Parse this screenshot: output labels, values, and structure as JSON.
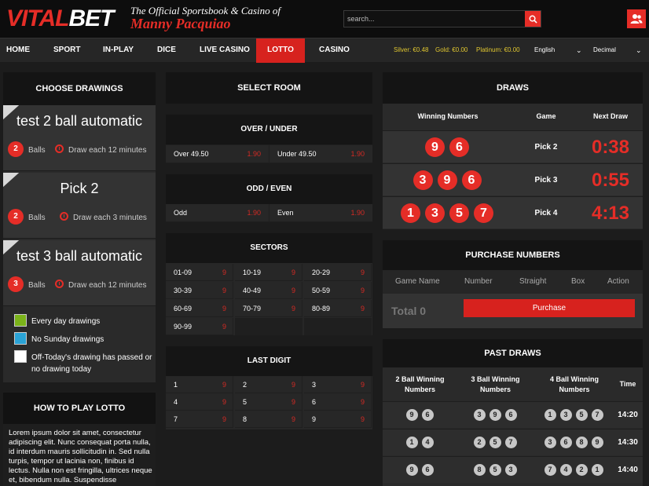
{
  "header": {
    "logo_part1": "VITAL",
    "logo_part2": "BET",
    "tagline_line1": "The Official Sportsbook & Casino of",
    "tagline_line2": "Manny Pacquiao",
    "search_placeholder": "search...",
    "brand_color": "#e52d27"
  },
  "nav": {
    "items": [
      "HOME",
      "SPORT",
      "IN-PLAY",
      "DICE",
      "LIVE CASINO",
      "LOTTO",
      "CASINO"
    ],
    "active": "LOTTO",
    "balances": [
      "Silver: €0.48",
      "Gold: €0.00",
      "Platinum: €0.00"
    ],
    "language": "English",
    "odds_format": "Decimal"
  },
  "choose": {
    "title": "CHOOSE DRAWINGS",
    "drawings": [
      {
        "name": "test 2 ball automatic",
        "balls": "2",
        "balls_label": "Balls",
        "every": "Draw each 12 minutes"
      },
      {
        "name": "Pick 2",
        "balls": "2",
        "balls_label": "Balls",
        "every": "Draw each 3 minutes"
      },
      {
        "name": "test 3 ball automatic",
        "balls": "3",
        "balls_label": "Balls",
        "every": "Draw each 12 minutes"
      }
    ],
    "legend": [
      {
        "color": "#7bb31a",
        "text": "Every day drawings"
      },
      {
        "color": "#2aa3d6",
        "text": "No Sunday drawings"
      },
      {
        "color": "#ffffff",
        "text": "Off-Today's drawing has passed or no drawing today"
      }
    ]
  },
  "howto": {
    "title": "HOW TO PLAY LOTTO",
    "text": "Lorem ipsum dolor sit amet, consectetur adipiscing elit. Nunc consequat porta nulla, id interdum mauris sollicitudin in. Sed nulla turpis, tempor ut lacinia non, finibus id lectus. Nulla non est fringilla, ultrices neque et, bibendum nulla. Suspendisse"
  },
  "room": {
    "title": "SELECT ROOM",
    "over_under": {
      "title": "OVER / UNDER",
      "bets": [
        {
          "label": "Over 49.50",
          "odd": "1.90"
        },
        {
          "label": "Under 49.50",
          "odd": "1.90"
        }
      ]
    },
    "odd_even": {
      "title": "ODD / EVEN",
      "bets": [
        {
          "label": "Odd",
          "odd": "1.90"
        },
        {
          "label": "Even",
          "odd": "1.90"
        }
      ]
    },
    "sectors": {
      "title": "SECTORS",
      "cells": [
        {
          "label": "01-09",
          "odd": "9"
        },
        {
          "label": "10-19",
          "odd": "9"
        },
        {
          "label": "20-29",
          "odd": "9"
        },
        {
          "label": "30-39",
          "odd": "9"
        },
        {
          "label": "40-49",
          "odd": "9"
        },
        {
          "label": "50-59",
          "odd": "9"
        },
        {
          "label": "60-69",
          "odd": "9"
        },
        {
          "label": "70-79",
          "odd": "9"
        },
        {
          "label": "80-89",
          "odd": "9"
        },
        {
          "label": "90-99",
          "odd": "9"
        }
      ]
    },
    "last_digit": {
      "title": "LAST DIGIT",
      "cells": [
        {
          "label": "1",
          "odd": "9"
        },
        {
          "label": "2",
          "odd": "9"
        },
        {
          "label": "3",
          "odd": "9"
        },
        {
          "label": "4",
          "odd": "9"
        },
        {
          "label": "5",
          "odd": "9"
        },
        {
          "label": "6",
          "odd": "9"
        },
        {
          "label": "7",
          "odd": "9"
        },
        {
          "label": "8",
          "odd": "9"
        },
        {
          "label": "9",
          "odd": "9"
        }
      ]
    }
  },
  "draws": {
    "title": "DRAWS",
    "col_winning": "Winning Numbers",
    "col_game": "Game",
    "col_next": "Next Draw",
    "rows": [
      {
        "numbers": [
          "9",
          "6"
        ],
        "game": "Pick 2",
        "next": "0:38"
      },
      {
        "numbers": [
          "3",
          "9",
          "6"
        ],
        "game": "Pick 3",
        "next": "0:55"
      },
      {
        "numbers": [
          "1",
          "3",
          "5",
          "7"
        ],
        "game": "Pick 4",
        "next": "4:13"
      }
    ]
  },
  "purchase": {
    "title": "PURCHASE NUMBERS",
    "columns": [
      "Game Name",
      "Number",
      "Straight",
      "Box",
      "Action"
    ],
    "total": "Total 0",
    "button": "Purchase"
  },
  "past": {
    "title": "PAST DRAWS",
    "col2_line1": "2 Ball Winning",
    "col2_line2": "Numbers",
    "col3_line1": "3 Ball Winning",
    "col3_line2": "Numbers",
    "col4_line1": "4 Ball Winning",
    "col4_line2": "Numbers",
    "col_time": "Time",
    "rows": [
      {
        "b2": [
          "9",
          "6"
        ],
        "b3": [
          "3",
          "9",
          "6"
        ],
        "b4": [
          "1",
          "3",
          "5",
          "7"
        ],
        "time": "14:20"
      },
      {
        "b2": [
          "1",
          "4"
        ],
        "b3": [
          "2",
          "5",
          "7"
        ],
        "b4": [
          "3",
          "6",
          "8",
          "9"
        ],
        "time": "14:30"
      },
      {
        "b2": [
          "9",
          "6"
        ],
        "b3": [
          "8",
          "5",
          "3"
        ],
        "b4": [
          "7",
          "4",
          "2",
          "1"
        ],
        "time": "14:40"
      }
    ]
  }
}
